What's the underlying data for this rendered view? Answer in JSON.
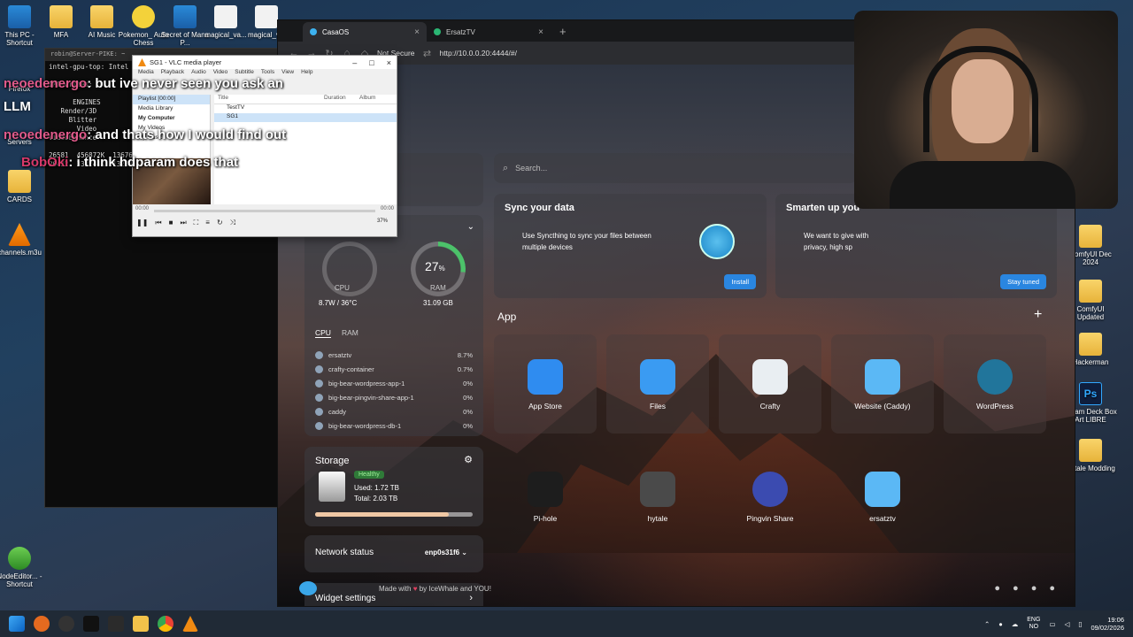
{
  "desktop": {
    "top_icons": [
      {
        "label": "This PC - Shortcut",
        "icon": "monitor-icon"
      },
      {
        "label": "MFA",
        "icon": "folder-icon"
      },
      {
        "label": "AI Music",
        "icon": "folder-icon"
      },
      {
        "label": "Pokemon_ Auto Chess",
        "icon": "game-icon"
      },
      {
        "label": "Secret of Mana P...",
        "icon": "app-icon"
      },
      {
        "label": "magical_va...",
        "icon": "file-icon"
      },
      {
        "label": "magical_v...",
        "icon": "file-icon"
      }
    ],
    "left_icons": [
      {
        "label": "Firefox",
        "icon": "firefox-icon"
      },
      {
        "label": "Servers",
        "icon": "folder-icon"
      },
      {
        "label": "CARDS",
        "icon": "folder-icon"
      },
      {
        "label": "channels.m3u",
        "icon": "vlc-icon"
      },
      {
        "label": "NodeEditor... - Shortcut",
        "icon": "app-icon"
      }
    ],
    "right_icons": [
      {
        "label": "ComfyUI Dec 2024",
        "icon": "folder-icon"
      },
      {
        "label": "ComfyUI Updated",
        "icon": "folder-icon"
      },
      {
        "label": "Hackerman",
        "icon": "folder-icon"
      },
      {
        "label": "Steam Deck Box Art LIBRE",
        "icon": "photoshop-icon"
      },
      {
        "label": "Hytale Modding",
        "icon": "folder-icon"
      }
    ],
    "llm_label": "LLM"
  },
  "terminal": {
    "title": "robin@Server-PIKE: ~",
    "lines": [
      "intel-gpu-top: Intel G",
      "",
      "IMC writes:",
      "",
      "      ENGINES",
      "   Render/3D",
      "     Blitter",
      "       Video",
      "VideoEnhance",
      "",
      "26581  456872K  136764",
      "26422  332244K  132836"
    ]
  },
  "chat": [
    {
      "user": "neoedenergo",
      "message": "but ive never seen you ask an"
    },
    {
      "user": "neoedenergo",
      "message": "and thats how I would find out"
    },
    {
      "user": "BobOki",
      "message": "i think hdparam does that"
    }
  ],
  "vlc": {
    "title": "SG1 - VLC media player",
    "menu": [
      "Media",
      "Playback",
      "Audio",
      "Video",
      "Subtitle",
      "Tools",
      "View",
      "Help"
    ],
    "sidebar": [
      "Playlist [00:00]",
      "Media Library",
      "My Computer",
      "My Videos",
      "My Music"
    ],
    "columns": [
      "Title",
      "Duration",
      "Album"
    ],
    "items": [
      "TestTV",
      "SG1"
    ],
    "time_start": "00:00",
    "time_end": "00:00",
    "volume": "37%"
  },
  "browser": {
    "tabs": [
      {
        "label": "CasaOS",
        "active": true
      },
      {
        "label": "ErsatzTV",
        "active": false
      }
    ],
    "security": "Not Secure",
    "url": "http://10.0.0.20:4444/#/"
  },
  "casaos": {
    "search_placeholder": "Search...",
    "stats": {
      "cpu_label": "CPU",
      "cpu_value": "8.7W / 36°C",
      "ram_percent": "27",
      "ram_unit": "%",
      "ram_label": "RAM",
      "ram_total": "31.09 GB",
      "tabs": [
        "CPU",
        "RAM"
      ],
      "processes": [
        {
          "name": "ersatztv",
          "value": "8.7%"
        },
        {
          "name": "crafty-container",
          "value": "0.7%"
        },
        {
          "name": "big-bear-wordpress-app-1",
          "value": "0%"
        },
        {
          "name": "big-bear-pingvin-share-app-1",
          "value": "0%"
        },
        {
          "name": "caddy",
          "value": "0%"
        },
        {
          "name": "big-bear-wordpress-db-1",
          "value": "0%"
        }
      ]
    },
    "storage": {
      "title": "Storage",
      "status": "Healthy",
      "used": "Used: 1.72 TB",
      "total": "Total: 2.03 TB",
      "used_fraction": 0.847
    },
    "network": {
      "title": "Network status",
      "interface": "enp0s31f6"
    },
    "widget_settings": "Widget settings",
    "sync": {
      "title": "Sync your data",
      "text": "Use Syncthing to sync your files between multiple devices",
      "button": "Install"
    },
    "smarten": {
      "title": "Smarten up you",
      "text": "We want to give with privacy, high sp",
      "button": "Stay tuned"
    },
    "app_section_title": "App",
    "apps": [
      {
        "label": "App Store",
        "color": "#2f8cf0"
      },
      {
        "label": "Files",
        "color": "#3a9bf2"
      },
      {
        "label": "Crafty",
        "color": "#e9eef2"
      },
      {
        "label": "Website (Caddy)",
        "color": "#5bb8f5"
      },
      {
        "label": "WordPress",
        "color": "#21759b"
      },
      {
        "label": "Pi-hole",
        "color": "#1d1d1d"
      },
      {
        "label": "hytale",
        "color": "#4a4a4a"
      },
      {
        "label": "Pingvin Share",
        "color": "#3b4bb0"
      },
      {
        "label": "ersatztv",
        "color": "#5bb8f5"
      }
    ],
    "footer_prefix": "Made with",
    "footer_suffix": "by IceWhale and YOU!"
  },
  "taskbar": {
    "lang_top": "ENG",
    "lang_bottom": "NO",
    "time": "19:06",
    "date": "09/02/2026"
  }
}
